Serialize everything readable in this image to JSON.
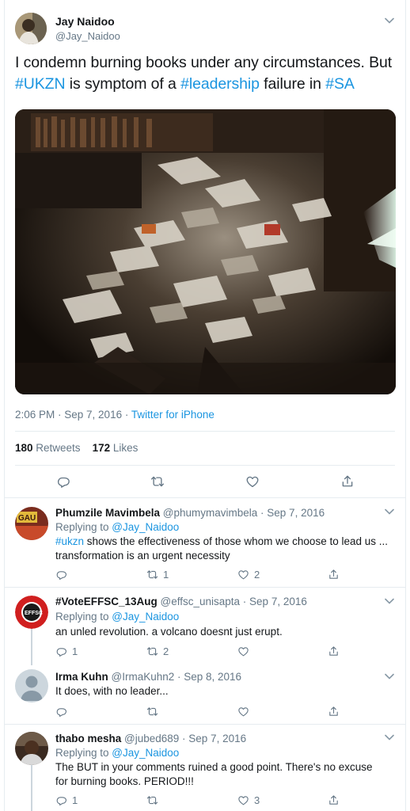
{
  "tweet": {
    "author_name": "Jay Naidoo",
    "author_handle": "@Jay_Naidoo",
    "text_parts": {
      "p1": "I condemn burning books under any circumstances. But ",
      "h1": "#UKZN",
      "p2": " is symptom of a ",
      "h2": "#leadership",
      "p3": " failure in ",
      "h3": "#SA"
    },
    "time": "2:06 PM · Sep 7, 2016 · ",
    "client": "Twitter for iPhone",
    "retweets_count": "180",
    "retweets_label": " Retweets",
    "likes_count": "172",
    "likes_label": " Likes"
  },
  "icons": {
    "reply": "reply-icon",
    "retweet": "retweet-icon",
    "like": "heart-icon",
    "share": "share-icon",
    "more": "chevron-down-icon"
  },
  "colors": {
    "link": "#1b95e0",
    "muted": "#657786",
    "divider": "#e6ecf0",
    "text": "#14171a"
  },
  "replies": [
    {
      "name": "Phumzile Mavimbela",
      "handle_date": " @phumymavimbela · Sep 7, 2016",
      "replying_prefix": "Replying to ",
      "replying_to": "@Jay_Naidoo",
      "body_tag": "#ukzn",
      "body": " shows the effectiveness of  those whom we choose to lead us ... transformation is an urgent necessity",
      "replies": "",
      "retweets": "1",
      "likes": "2"
    },
    {
      "name": "#VoteEFFSC_13Aug",
      "handle_date": " @effsc_unisapta · Sep 7, 2016",
      "replying_prefix": "Replying to ",
      "replying_to": "@Jay_Naidoo",
      "body": "an unled revolution. a volcano doesnt just erupt.",
      "replies": "1",
      "retweets": "2",
      "likes": ""
    },
    {
      "name": "Irma Kuhn",
      "handle_date": " @IrmaKuhn2 · Sep 8, 2016",
      "body": "It does, with no leader...",
      "replies": "",
      "retweets": "",
      "likes": ""
    },
    {
      "name": "thabo mesha",
      "handle_date": " @jubed689 · Sep 7, 2016",
      "replying_prefix": "Replying to ",
      "replying_to": "@Jay_Naidoo",
      "body": "The BUT in your comments ruined a good point. There's no excuse for burning books. PERIOD!!!",
      "replies": "1",
      "retweets": "",
      "likes": "3"
    }
  ]
}
